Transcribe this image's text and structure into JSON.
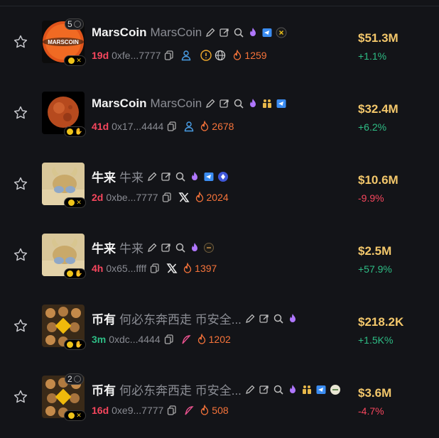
{
  "rows": [
    {
      "symbol": "MarsCoin",
      "name": "MarsCoin",
      "age": "19d",
      "age_color": "red",
      "address": "0xfe...7777",
      "holders": "1259",
      "mcap": "$51.3M",
      "change": "+1.1%",
      "change_dir": "up",
      "count": "5",
      "avatar": "marscoin-logo",
      "avatar_text": "MARSCOIN"
    },
    {
      "symbol": "MarsCoin",
      "name": "MarsCoin",
      "age": "41d",
      "age_color": "red",
      "address": "0x17...4444",
      "holders": "2678",
      "mcap": "$32.4M",
      "change": "+6.2%",
      "change_dir": "up",
      "avatar": "mars-planet"
    },
    {
      "symbol": "牛来",
      "name": "牛来",
      "age": "2d",
      "age_color": "red",
      "address": "0xbe...7777",
      "holders": "2024",
      "mcap": "$10.6M",
      "change": "-9.9%",
      "change_dir": "down",
      "avatar": "bull"
    },
    {
      "symbol": "牛来",
      "name": "牛来",
      "age": "4h",
      "age_color": "red",
      "address": "0x65...ffff",
      "holders": "1397",
      "mcap": "$2.5M",
      "change": "+57.9%",
      "change_dir": "up",
      "avatar": "bull"
    },
    {
      "symbol": "币有",
      "name": "何必东奔西走 币安全...",
      "age": "3m",
      "age_color": "green",
      "address": "0xdc...4444",
      "holders": "1202",
      "mcap": "$218.2K",
      "change": "+1.5K%",
      "change_dir": "up",
      "avatar": "binance-group"
    },
    {
      "symbol": "币有",
      "name": "何必东奔西走 币安全...",
      "age": "16d",
      "age_color": "red",
      "address": "0xe9...7777",
      "holders": "508",
      "mcap": "$3.6M",
      "change": "-4.7%",
      "change_dir": "down",
      "count": "2",
      "avatar": "binance-group"
    }
  ],
  "colors": {
    "background": "#131418",
    "gain": "#2ebd85",
    "loss": "#f6465d",
    "mcap": "#f3c76b",
    "holders": "#f6733a"
  }
}
